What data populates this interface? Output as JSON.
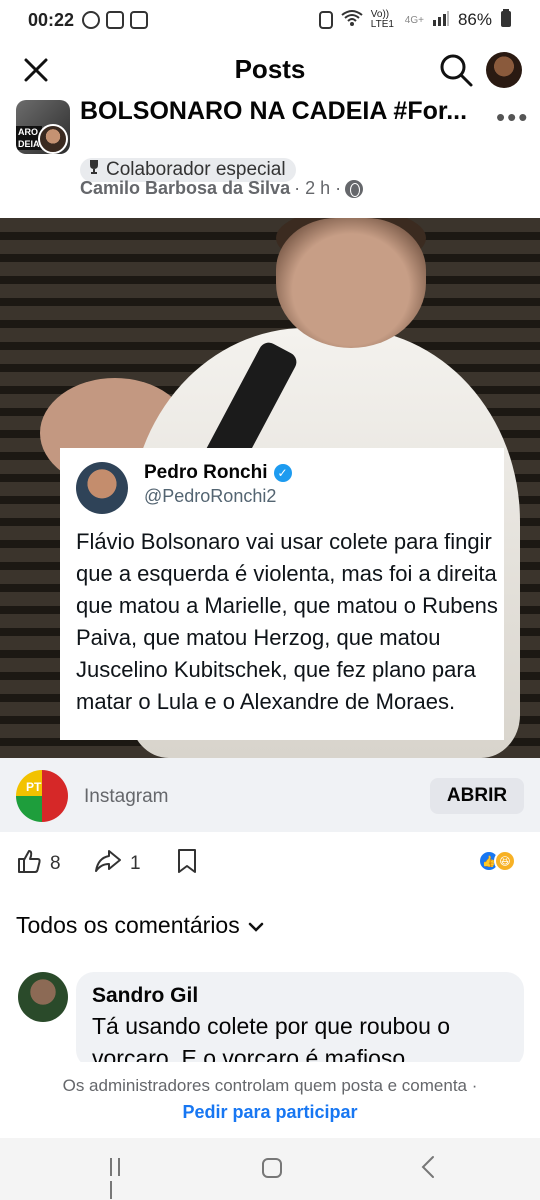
{
  "status_bar": {
    "time": "00:22",
    "network_label": "Vo)) LTE1",
    "network_type": "4G+",
    "battery": "86%"
  },
  "topbar": {
    "title": "Posts"
  },
  "post": {
    "group_name": "BOLSONARO NA CADEIA #For...",
    "group_thumb_text": "ARO\nDEIA",
    "badge": "Colaborador especial",
    "author": "Camilo Barbosa da Silva",
    "time": "· 2 h ·"
  },
  "tweet": {
    "name": "Pedro Ronchi",
    "handle": "@PedroRonchi2",
    "text": "Flávio Bolsonaro vai usar colete para fingir que a esquerda é violenta, mas foi a direita que matou a Marielle, que matou o Rubens Paiva, que matou Herzog, que matou Juscelino Kubitschek, que fez plano para matar o Lula e o Alexandre de Moraes."
  },
  "link": {
    "source": "Instagram",
    "open_label": "ABRIR"
  },
  "actions": {
    "likes": "8",
    "shares": "1"
  },
  "comments": {
    "header": "Todos os comentários",
    "items": [
      {
        "name": "Sandro Gil",
        "text": "Tá usando colete por que roubou o vorcaro. E o vorcaro é mafioso"
      }
    ]
  },
  "admin_note": {
    "line1": "Os administradores controlam quem posta e comenta ·",
    "line2": "Pedir para participar"
  },
  "colors": {
    "accent": "#1877f2",
    "secondary_text": "#65676b",
    "link_bar_bg": "#f0f2f5"
  }
}
